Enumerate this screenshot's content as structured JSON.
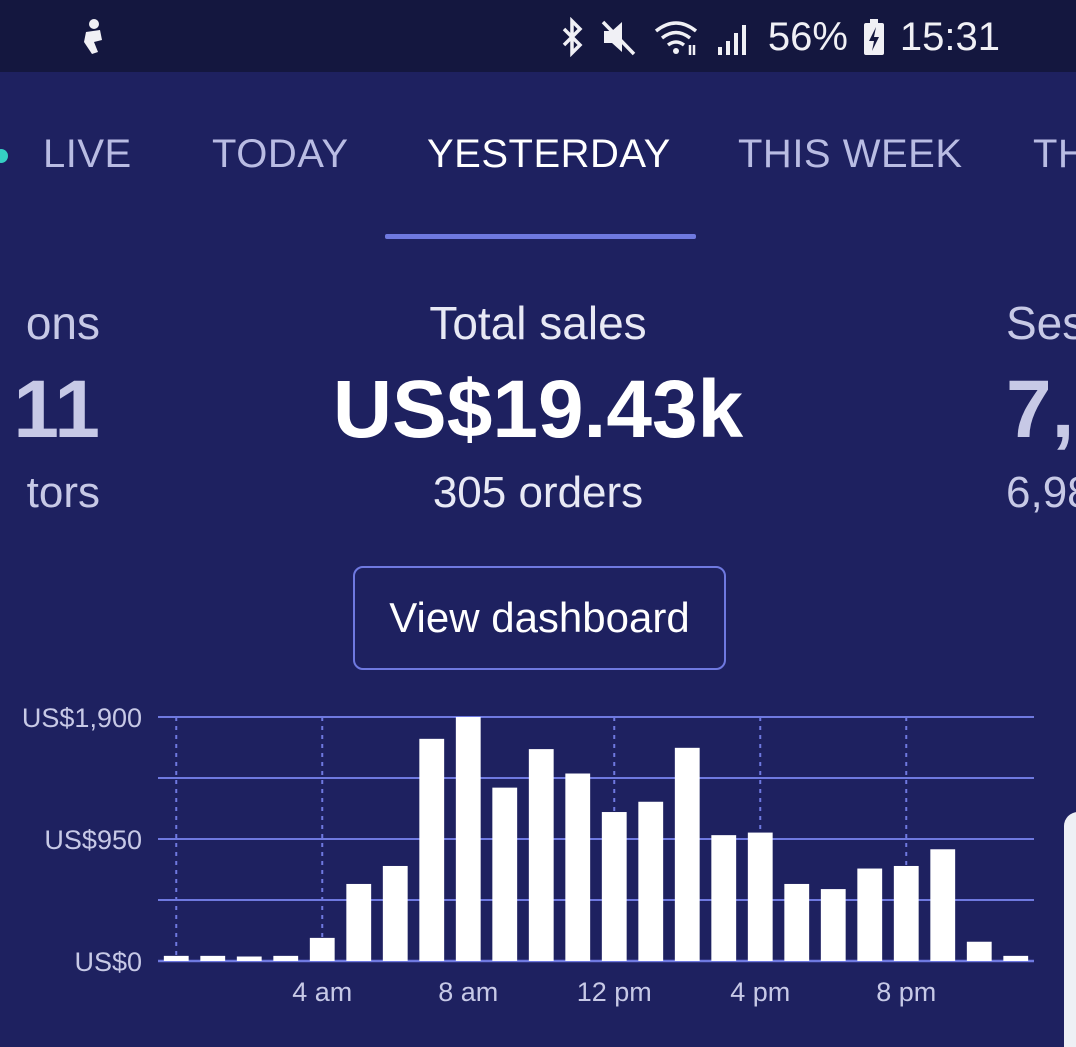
{
  "status_bar": {
    "battery": "56%",
    "time": "15:31",
    "icons": [
      "notification-icon",
      "bluetooth-icon",
      "mute-icon",
      "wifi-icon",
      "signal-icon",
      "battery-charging-icon"
    ]
  },
  "tabs": [
    {
      "label": "LIVE"
    },
    {
      "label": "TODAY"
    },
    {
      "label": "YESTERDAY"
    },
    {
      "label": "THIS WEEK"
    },
    {
      "label": "TH"
    }
  ],
  "active_tab": "YESTERDAY",
  "metrics": {
    "left": {
      "title": "ons",
      "value": "11",
      "sub": "tors"
    },
    "center": {
      "title": "Total sales",
      "value": "US$19.43k",
      "sub": "305 orders"
    },
    "right": {
      "title": "Ses",
      "value": "7,",
      "sub": "6,98"
    }
  },
  "view_dashboard_label": "View dashboard",
  "colors": {
    "background": "#1e2160",
    "status_bar": "#14173f",
    "accent": "#6f79e0",
    "live_dot": "#35d0c4",
    "bar": "#ffffff"
  },
  "chart_data": {
    "type": "bar",
    "x_tick_labels": [
      "4 am",
      "8 am",
      "12 pm",
      "4 pm",
      "8 pm"
    ],
    "y_tick_labels": [
      "US$1,900",
      "US$950",
      "US$0"
    ],
    "ylim": [
      0,
      1900
    ],
    "hours": [
      0,
      1,
      2,
      3,
      4,
      5,
      6,
      7,
      8,
      9,
      10,
      11,
      12,
      13,
      14,
      15,
      16,
      17,
      18,
      19,
      20,
      21,
      22,
      23
    ],
    "values": [
      40,
      40,
      35,
      40,
      180,
      600,
      740,
      1730,
      1900,
      1350,
      1650,
      1460,
      1160,
      1240,
      1660,
      980,
      1000,
      600,
      560,
      720,
      740,
      870,
      150,
      40
    ],
    "grid": true
  }
}
